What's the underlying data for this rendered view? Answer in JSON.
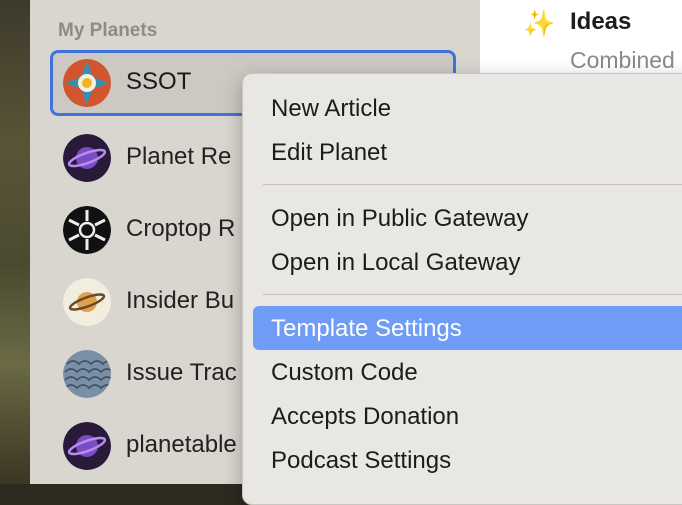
{
  "sidebar": {
    "section_title": "My Planets",
    "planets": [
      {
        "label": "SSOT",
        "icon": "ssot-avatar-icon",
        "selected": true
      },
      {
        "label": "Planet Re",
        "icon": "saturn-avatar-icon"
      },
      {
        "label": "Croptop R",
        "icon": "croptop-avatar-icon"
      },
      {
        "label": "Insider Bu",
        "icon": "insider-planet-avatar-icon"
      },
      {
        "label": "Issue Trac",
        "icon": "issue-tracker-avatar-icon"
      },
      {
        "label": "planetable",
        "icon": "planetable-avatar-icon"
      }
    ]
  },
  "main": {
    "icon": "sparkles-icon",
    "title": "Ideas",
    "subtitle": "Combined"
  },
  "context_menu": {
    "groups": [
      [
        "New Article",
        "Edit Planet"
      ],
      [
        "Open in Public Gateway",
        "Open in Local Gateway"
      ],
      [
        "Template Settings",
        "Custom Code",
        "Accepts Donation",
        "Podcast Settings"
      ]
    ],
    "highlighted": "Template Settings"
  },
  "colors": {
    "selection_border": "#3f74e0",
    "menu_highlight": "#6f9cf6",
    "sidebar_bg": "#d9d5cf"
  }
}
